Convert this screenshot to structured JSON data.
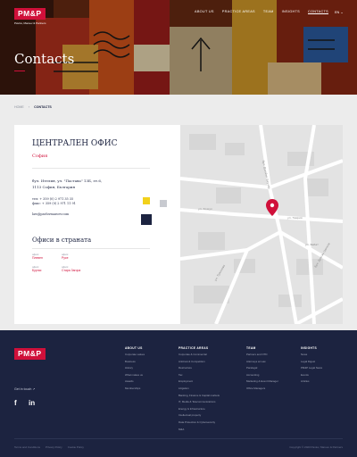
{
  "header": {
    "logo": "PM&P",
    "logo_sub": "Pavlov, Maroev & Partners",
    "nav": [
      "ABOUT US",
      "PRACTICE AREAS",
      "TEAM",
      "INSIGHTS",
      "CONTACTS"
    ],
    "lang": "EN ⌄",
    "title": "Contacts"
  },
  "breadcrumb": {
    "home": "HOME",
    "separator": "›",
    "current": "CONTACTS"
  },
  "office": {
    "title": "ЦЕНТРАЛЕН ОФИС",
    "city": "София",
    "address_line1": "бул. Ителия, ул. \"Пастава\" 13Б, ет.6,",
    "address_line2": "1113 София, България",
    "tel": "тел: + 359 (0) 2 971 35 35",
    "fax": "факс: + 359 (0) 2 971 11 91",
    "email": "law@pavlovmaroev.com",
    "colors": {
      "accent": "#d0103a",
      "yellow": "#f2d11b",
      "grey": "#c8cad0",
      "navy": "#1c2340"
    }
  },
  "country_offices": {
    "title": "Офиси в страната",
    "items": [
      {
        "label": "офис",
        "name": "Плевен"
      },
      {
        "label": "офис",
        "name": "Русе"
      },
      {
        "label": "офис",
        "name": "Бургас"
      },
      {
        "label": "офис",
        "name": "Стара Загора"
      }
    ]
  },
  "map": {
    "streets": [
      "бул. Джеймс Баучер",
      "ул. Таврия",
      "ул. Кожух",
      "ул. Бабат",
      "бул. Драган Цанков",
      "ул. Траянови"
    ]
  },
  "footer": {
    "logo": "PM&P",
    "get_in_touch": "Get in touch ↗",
    "facebook": "f",
    "linkedin": "in",
    "columns": [
      {
        "head": "ABOUT US",
        "items": [
          "Corporate values",
          "Business",
          "History",
          "What makes us",
          "Awards",
          "Memberships"
        ]
      },
      {
        "head": "PRACTICE AREAS",
        "items": [
          "Corporate & Commercial",
          "Antitrust & Competition",
          "Restructure",
          "Tax",
          "Employment",
          "Litigation",
          "Banking, Finance & Capital markets",
          "IT, Media & Telecommunications",
          "Energy & Infrastructure",
          "Intellectual property",
          "Data Protection & Cybersecurity",
          "M&A"
        ]
      },
      {
        "head": "TEAM",
        "items": [
          "Partners and OTD",
          "Attorneys at Law",
          "Paralegal",
          "Accounting",
          "Marketing & Event Manager",
          "Office Managers"
        ]
      },
      {
        "head": "INSIGHTS",
        "items": [
          "News",
          "Legal Digest",
          "PM&P Legal News",
          "Events",
          "Articles"
        ]
      }
    ],
    "bottom_links": [
      "Terms and Conditions",
      "Privacy Policy",
      "Cookie Policy"
    ],
    "copyright": "Copyright © 2023 Pavlov, Maroev & Partners"
  }
}
